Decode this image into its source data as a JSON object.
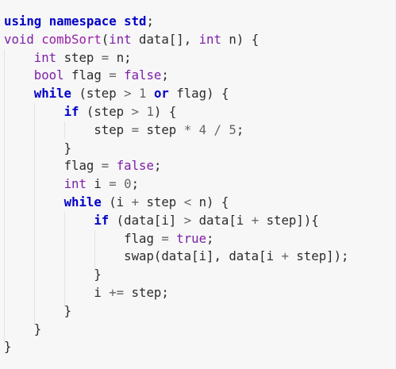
{
  "colors": {
    "keyword": "#0000ff",
    "keyword_bold": "#0000c8",
    "type": "#7c1fa8",
    "function": "#9b1fa8",
    "plain": "#2b2b2b",
    "number": "#666666",
    "operator": "#666666"
  },
  "code_lines": [
    [
      [
        "using",
        "kwb"
      ],
      [
        " ",
        "p"
      ],
      [
        "namespace",
        "kwb"
      ],
      [
        " ",
        "p"
      ],
      [
        "std",
        "kwb"
      ],
      [
        ";",
        "p"
      ]
    ],
    [
      [
        "void",
        "ty"
      ],
      [
        " ",
        "p"
      ],
      [
        "combSort",
        "fn"
      ],
      [
        "(",
        "p"
      ],
      [
        "int",
        "ty"
      ],
      [
        " data[], ",
        "p"
      ],
      [
        "int",
        "ty"
      ],
      [
        " n) {",
        "p"
      ]
    ],
    [
      [
        "    ",
        "p"
      ],
      [
        "int",
        "ty"
      ],
      [
        " step ",
        "p"
      ],
      [
        "=",
        "op"
      ],
      [
        " n;",
        "p"
      ]
    ],
    [
      [
        "    ",
        "p"
      ],
      [
        "bool",
        "ty"
      ],
      [
        " flag ",
        "p"
      ],
      [
        "=",
        "op"
      ],
      [
        " ",
        "p"
      ],
      [
        "false",
        "ty"
      ],
      [
        ";",
        "p"
      ]
    ],
    [
      [
        "    ",
        "p"
      ],
      [
        "while",
        "kwb"
      ],
      [
        " (step ",
        "p"
      ],
      [
        ">",
        "op"
      ],
      [
        " ",
        "p"
      ],
      [
        "1",
        "num"
      ],
      [
        " ",
        "p"
      ],
      [
        "or",
        "kwb"
      ],
      [
        " flag) {",
        "p"
      ]
    ],
    [
      [
        "        ",
        "p"
      ],
      [
        "if",
        "kwb"
      ],
      [
        " (step ",
        "p"
      ],
      [
        ">",
        "op"
      ],
      [
        " ",
        "p"
      ],
      [
        "1",
        "num"
      ],
      [
        ") {",
        "p"
      ]
    ],
    [
      [
        "            ",
        "p"
      ],
      [
        "step ",
        "p"
      ],
      [
        "=",
        "op"
      ],
      [
        " step ",
        "p"
      ],
      [
        "*",
        "op"
      ],
      [
        " ",
        "p"
      ],
      [
        "4",
        "num"
      ],
      [
        " ",
        "p"
      ],
      [
        "/",
        "op"
      ],
      [
        " ",
        "p"
      ],
      [
        "5",
        "num"
      ],
      [
        ";",
        "p"
      ]
    ],
    [
      [
        "        ",
        "p"
      ],
      [
        "}",
        "p"
      ]
    ],
    [
      [
        "        ",
        "p"
      ],
      [
        "flag ",
        "p"
      ],
      [
        "=",
        "op"
      ],
      [
        " ",
        "p"
      ],
      [
        "false",
        "ty"
      ],
      [
        ";",
        "p"
      ]
    ],
    [
      [
        "        ",
        "p"
      ],
      [
        "int",
        "ty"
      ],
      [
        " i ",
        "p"
      ],
      [
        "=",
        "op"
      ],
      [
        " ",
        "p"
      ],
      [
        "0",
        "num"
      ],
      [
        ";",
        "p"
      ]
    ],
    [
      [
        "        ",
        "p"
      ],
      [
        "while",
        "kwb"
      ],
      [
        " (i ",
        "p"
      ],
      [
        "+",
        "op"
      ],
      [
        " step ",
        "p"
      ],
      [
        "<",
        "op"
      ],
      [
        " n) {",
        "p"
      ]
    ],
    [
      [
        "            ",
        "p"
      ],
      [
        "if",
        "kwb"
      ],
      [
        " (data[i] ",
        "p"
      ],
      [
        ">",
        "op"
      ],
      [
        " data[i ",
        "p"
      ],
      [
        "+",
        "op"
      ],
      [
        " step]){",
        "p"
      ]
    ],
    [
      [
        "                ",
        "p"
      ],
      [
        "flag ",
        "p"
      ],
      [
        "=",
        "op"
      ],
      [
        " ",
        "p"
      ],
      [
        "true",
        "ty"
      ],
      [
        ";",
        "p"
      ]
    ],
    [
      [
        "                ",
        "p"
      ],
      [
        "swap(data[i], data[i ",
        "p"
      ],
      [
        "+",
        "op"
      ],
      [
        " step]);",
        "p"
      ]
    ],
    [
      [
        "            ",
        "p"
      ],
      [
        "}",
        "p"
      ]
    ],
    [
      [
        "            ",
        "p"
      ],
      [
        "i ",
        "p"
      ],
      [
        "+=",
        "op"
      ],
      [
        " step;",
        "p"
      ]
    ],
    [
      [
        "        ",
        "p"
      ],
      [
        "}",
        "p"
      ]
    ],
    [
      [
        "    ",
        "p"
      ],
      [
        "}",
        "p"
      ]
    ],
    [
      [
        "}",
        "p"
      ]
    ]
  ]
}
